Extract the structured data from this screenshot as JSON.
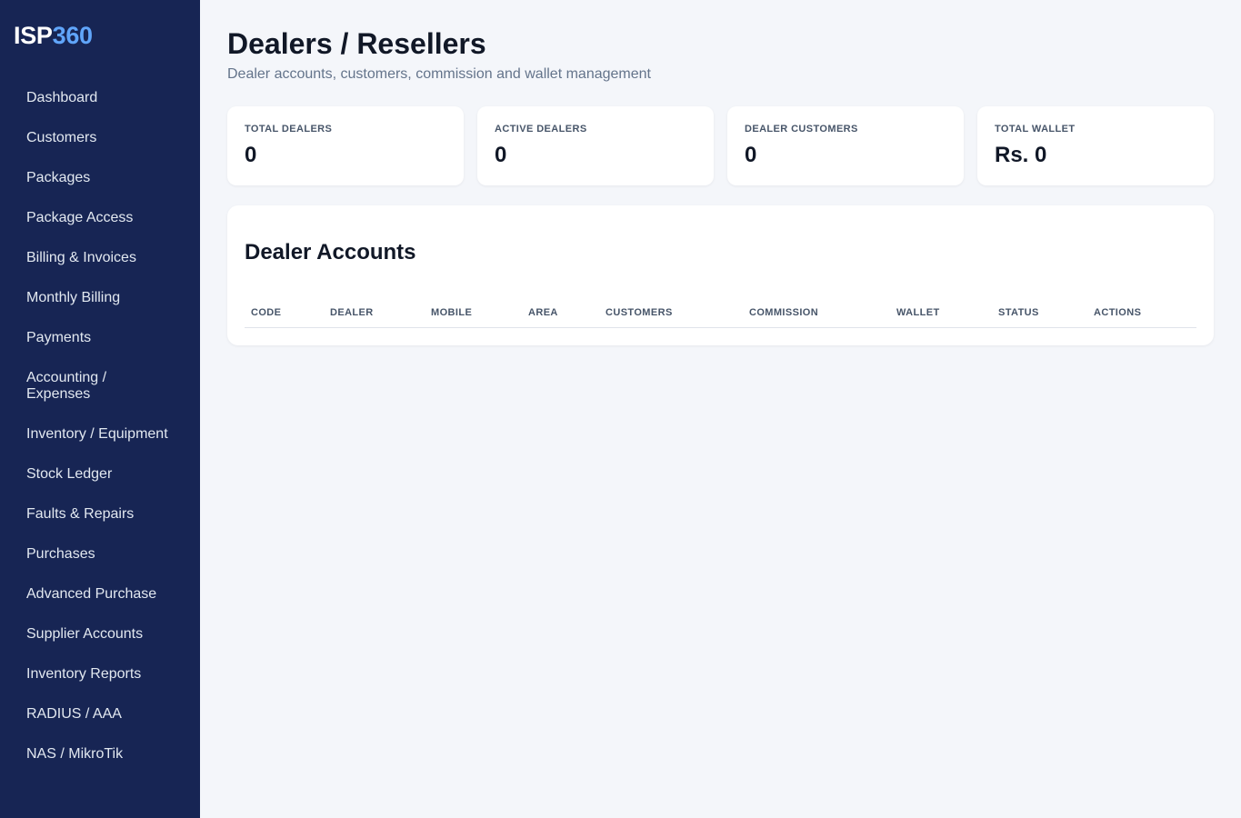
{
  "brand": {
    "name_part1": "ISP",
    "name_part2": "360"
  },
  "sidebar": {
    "items": [
      {
        "label": "Dashboard"
      },
      {
        "label": "Customers"
      },
      {
        "label": "Packages"
      },
      {
        "label": "Package Access"
      },
      {
        "label": "Billing & Invoices"
      },
      {
        "label": "Monthly Billing"
      },
      {
        "label": "Payments"
      },
      {
        "label": "Accounting / Expenses"
      },
      {
        "label": "Inventory / Equipment"
      },
      {
        "label": "Stock Ledger"
      },
      {
        "label": "Faults & Repairs"
      },
      {
        "label": "Purchases"
      },
      {
        "label": "Advanced Purchase"
      },
      {
        "label": "Supplier Accounts"
      },
      {
        "label": "Inventory Reports"
      },
      {
        "label": "RADIUS / AAA"
      },
      {
        "label": "NAS / MikroTik"
      }
    ]
  },
  "header": {
    "title": "Dealers / Resellers",
    "subtitle": "Dealer accounts, customers, commission and wallet management"
  },
  "stats": [
    {
      "label": "TOTAL DEALERS",
      "value": "0"
    },
    {
      "label": "ACTIVE DEALERS",
      "value": "0"
    },
    {
      "label": "DEALER CUSTOMERS",
      "value": "0"
    },
    {
      "label": "TOTAL WALLET",
      "value": "Rs. 0"
    }
  ],
  "dealer_table": {
    "title": "Dealer Accounts",
    "columns": [
      "CODE",
      "DEALER",
      "MOBILE",
      "AREA",
      "CUSTOMERS",
      "COMMISSION",
      "WALLET",
      "STATUS",
      "ACTIONS"
    ],
    "rows": []
  },
  "colors": {
    "sidebar_bg": "#172554",
    "accent": "#60a5fa",
    "page_bg": "#f4f6fa"
  }
}
